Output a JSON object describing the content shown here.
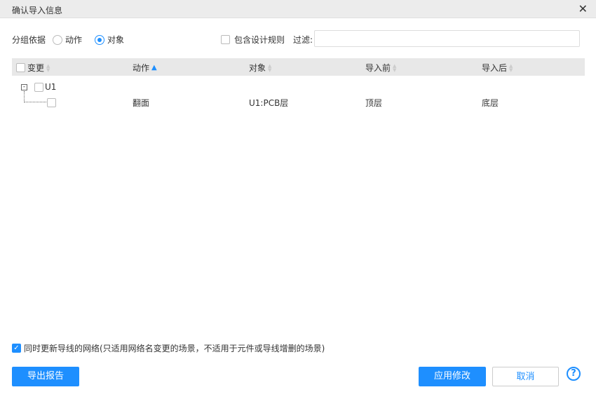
{
  "dialog": {
    "title": "确认导入信息",
    "close": "✕"
  },
  "group": {
    "label": "分组依据",
    "options": [
      "动作",
      "对象"
    ],
    "selected": "对象"
  },
  "include_rules": {
    "label": "包含设计规则",
    "checked": false
  },
  "filter": {
    "label": "过滤:",
    "value": ""
  },
  "table": {
    "columns": [
      {
        "label": "变更"
      },
      {
        "label": "动作",
        "sorted": "asc"
      },
      {
        "label": "对象"
      },
      {
        "label": "导入前"
      },
      {
        "label": "导入后"
      }
    ],
    "groups": [
      {
        "name": "U1",
        "rows": [
          {
            "action": "翻面",
            "object": "U1:PCB层",
            "before": "顶层",
            "after": "底层"
          }
        ]
      }
    ]
  },
  "update_nets": {
    "label": "同时更新导线的网络(只适用网络名变更的场景，不适用于元件或导线增删的场景)",
    "checked": true
  },
  "buttons": {
    "export": "导出报告",
    "apply": "应用修改",
    "cancel": "取消",
    "help": "?"
  },
  "colors": {
    "accent": "#1e8fff"
  }
}
